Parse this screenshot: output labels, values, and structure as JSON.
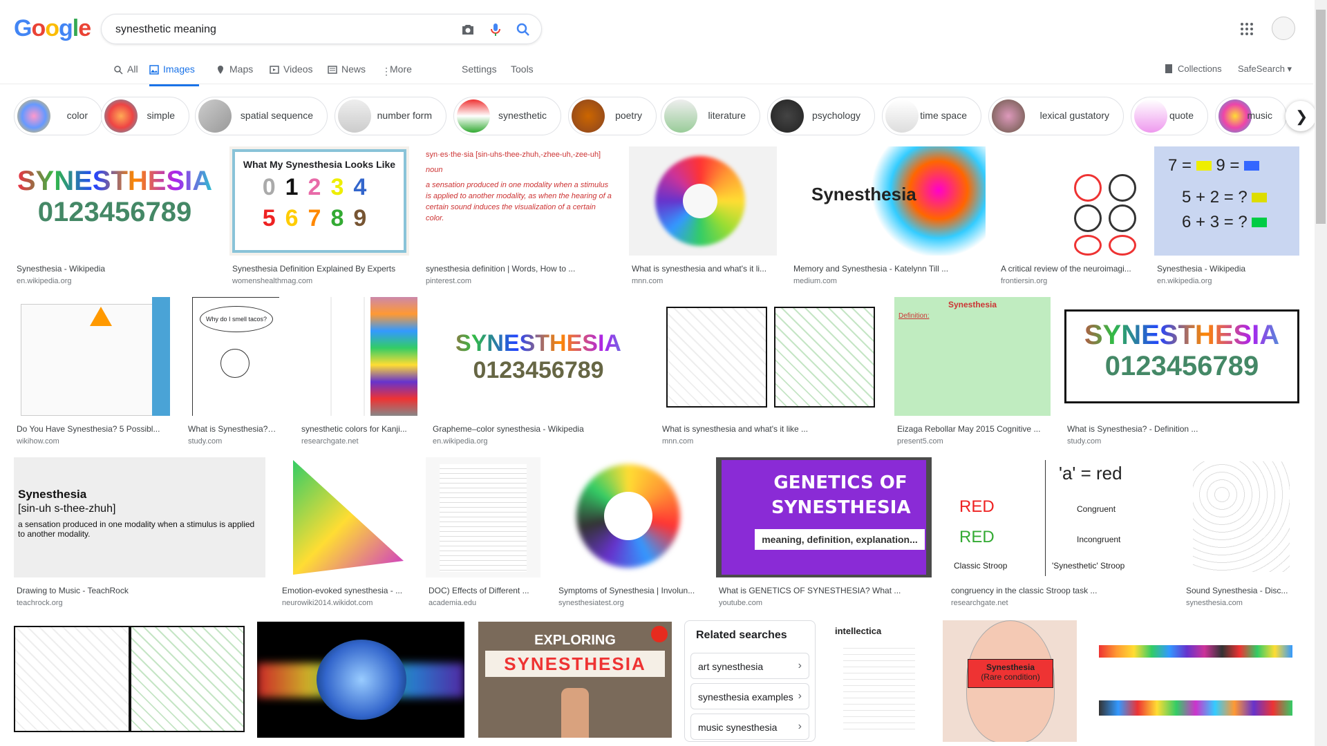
{
  "search": {
    "query": "synesthetic meaning"
  },
  "logo": {
    "letters": [
      "G",
      "o",
      "o",
      "g",
      "l",
      "e"
    ],
    "colors": [
      "#4285f4",
      "#ea4335",
      "#fbbc05",
      "#4285f4",
      "#34a853",
      "#ea4335"
    ]
  },
  "tabs": [
    {
      "label": "All",
      "icon": "search-icon"
    },
    {
      "label": "Images",
      "icon": "image-icon"
    },
    {
      "label": "Maps",
      "icon": "map-icon"
    },
    {
      "label": "Videos",
      "icon": "video-icon"
    },
    {
      "label": "News",
      "icon": "news-icon"
    },
    {
      "label": "More",
      "icon": "more-vert-icon"
    }
  ],
  "tools": {
    "settings": "Settings",
    "tools": "Tools",
    "collections": "Collections",
    "safesearch": "SafeSearch"
  },
  "chips": [
    "color",
    "simple",
    "spatial sequence",
    "number form",
    "synesthetic",
    "poetry",
    "literature",
    "psychology",
    "time space",
    "lexical gustatory",
    "quote",
    "music"
  ],
  "results": [
    {
      "title": "Synesthesia - Wikipedia",
      "source": "en.wikipedia.org"
    },
    {
      "title": "Synesthesia Definition Explained By Experts",
      "source": "womenshealthmag.com"
    },
    {
      "title": "synesthesia definition | Words, How to ...",
      "source": "pinterest.com"
    },
    {
      "title": "What is synesthesia and what's it li...",
      "source": "mnn.com"
    },
    {
      "title": "Memory and Synesthesia - Katelynn Till ...",
      "source": "medium.com"
    },
    {
      "title": "A critical review of the neuroimagi...",
      "source": "frontiersin.org"
    },
    {
      "title": "Synesthesia - Wikipedia",
      "source": "en.wikipedia.org"
    },
    {
      "title": "Do You Have Synesthesia? 5 Possibl...",
      "source": "wikihow.com"
    },
    {
      "title": "What is Synesthesia? ...",
      "source": "study.com"
    },
    {
      "title": "synesthetic colors for Kanji...",
      "source": "researchgate.net"
    },
    {
      "title": "Grapheme–color synesthesia - Wikipedia",
      "source": "en.wikipedia.org"
    },
    {
      "title": "What is synesthesia and what's it like ...",
      "source": "mnn.com"
    },
    {
      "title": "Eizaga Rebollar May 2015 Cognitive ...",
      "source": "present5.com"
    },
    {
      "title": "What is Synesthesia? - Definition ...",
      "source": "study.com"
    },
    {
      "title": "Drawing to Music - TeachRock",
      "source": "teachrock.org"
    },
    {
      "title": "Emotion-evoked synesthesia - ...",
      "source": "neurowiki2014.wikidot.com"
    },
    {
      "title": "DOC) Effects of Different ...",
      "source": "academia.edu"
    },
    {
      "title": "Symptoms of Synesthesia | Involun...",
      "source": "synesthesiatest.org"
    },
    {
      "title": "What is GENETICS OF SYNESTHESIA? What ...",
      "source": "youtube.com"
    },
    {
      "title": "congruency in the classic Stroop task ...",
      "source": "researchgate.net"
    },
    {
      "title": "Sound Synesthesia - Disc...",
      "source": "synesthesia.com"
    }
  ],
  "image_text": {
    "syn_word": "SYNESTHESIA",
    "syn_digits": "0123456789",
    "looks_like": "What My Synesthesia Looks Like",
    "dict_head": "syn·es·the·sia [sin-uhs-thee-zhuh,-zhee-uh,-zee-uh]",
    "dict_pos": "noun",
    "dict_def": "a sensation produced in one modality when a stimulus is applied to another modality, as when the hearing of a certain sound induces the visualization of a certain color.",
    "synesthesia_mixed": "Synesthesia",
    "genetics_1": "GENETICS OF",
    "genetics_2": "SYNESTHESIA",
    "genetics_3": "meaning, definition, explanation...",
    "teach_word": "Synesthesia",
    "teach_pron": "[sin-uh s-thee-zhuh]",
    "teach_def": "a sensation produced in one modality when a stimulus is applied to another modality.",
    "stroop_a": "'a' = red",
    "stroop_red": "RED",
    "stroop_congruent": "Congruent",
    "stroop_incongruent": "Incongruent",
    "stroop_classic": "Classic Stroop",
    "stroop_synesthetic": "'Synesthetic' Stroop",
    "math_1": "7 =",
    "math_2": "9 =",
    "math_3": "5 + 2 = ?",
    "math_4": "6 + 3 = ?",
    "exploring_1": "EXPLORING",
    "exploring_2": "SYNESTHESIA",
    "intellectica": "intellectica",
    "rare_1": "Synesthesia",
    "rare_2": "(Rare condition)",
    "why_smell": "Why do I smell tacos?",
    "present_def": "Definition:",
    "present_title": "Synesthesia"
  },
  "related": {
    "title": "Related searches",
    "items": [
      "art synesthesia",
      "synesthesia examples",
      "music synesthesia"
    ]
  }
}
